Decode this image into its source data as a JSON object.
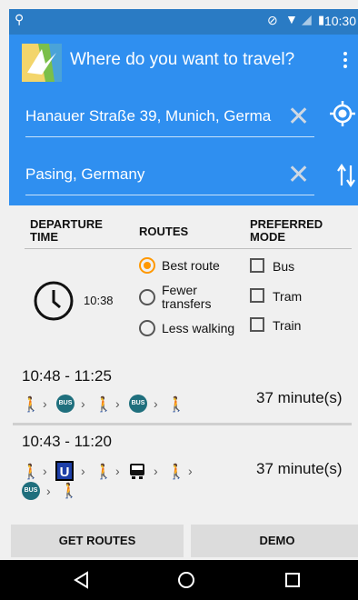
{
  "status_bar": {
    "time": "10:30"
  },
  "app_bar": {
    "title": "Where do you want to travel?"
  },
  "origin": {
    "value": "Hanauer Straße 39, Munich, Germa"
  },
  "destination": {
    "value": "Pasing, Germany"
  },
  "columns": {
    "departure_time": "DEPARTURE TIME",
    "routes": "ROUTES",
    "preferred_mode": "PREFERRED MODE"
  },
  "departure": {
    "time": "10:38"
  },
  "route_options": [
    {
      "label": "Best route",
      "selected": true
    },
    {
      "label": "Fewer transfers",
      "selected": false
    },
    {
      "label": "Less walking",
      "selected": false
    }
  ],
  "mode_options": [
    {
      "label": "Bus",
      "checked": false
    },
    {
      "label": "Tram",
      "checked": false
    },
    {
      "label": "Train",
      "checked": false
    }
  ],
  "results": [
    {
      "time_range": "10:48 - 11:25",
      "duration": "37 minute(s)",
      "legs": [
        "walk",
        "bus",
        "walk",
        "bus",
        "walk"
      ]
    },
    {
      "time_range": "10:43 - 11:20",
      "duration": "37 minute(s)",
      "legs": [
        "walk",
        "ubahn",
        "walk",
        "tram",
        "walk",
        "bus",
        "walk"
      ]
    }
  ],
  "icons": {
    "bus_badge": "BUS",
    "ubahn_badge": "U"
  },
  "buttons": {
    "get_routes": "GET ROUTES",
    "demo": "DEMO"
  },
  "colors": {
    "primary": "#2f8ff0",
    "status_bar": "#2a7bc4",
    "accent": "#ff9800"
  }
}
